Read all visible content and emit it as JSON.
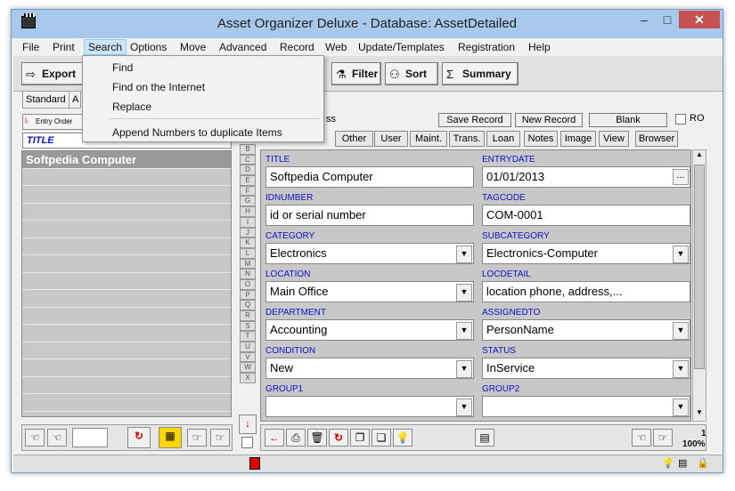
{
  "window": {
    "title": "Asset Organizer Deluxe - Database: AssetDetailed",
    "min": "–",
    "max": "□",
    "close": "✕"
  },
  "menu": [
    "File",
    "Print",
    "Search",
    "Options",
    "Move",
    "Advanced",
    "Record",
    "Web",
    "Update/Templates",
    "Registration",
    "Help"
  ],
  "toolbar": {
    "export": "Export",
    "filter": "Filter",
    "sort": "Sort",
    "summary": "Summary"
  },
  "search_menu": [
    "Find",
    "Find on the Internet",
    "Replace",
    "Append Numbers to duplicate Items"
  ],
  "left": {
    "tab_standard": "Standard",
    "tab_a": "A",
    "entry_order": "Entry Order",
    "list_header": "TITLE",
    "items": [
      "Softpedia Computer",
      "",
      "",
      "",
      "",
      "",
      "",
      "",
      "",
      "",
      "",
      "",
      "",
      "",
      ""
    ]
  },
  "record_bar": {
    "ss": "ss",
    "save": "Save Record",
    "new": "New Record",
    "blank": "Blank",
    "ro": "RO"
  },
  "tabs": [
    "Other",
    "User",
    "Maint.",
    "Trans.",
    "Loan",
    "Notes",
    "Image",
    "View",
    "Browser"
  ],
  "alpha": [
    "B",
    "C",
    "D",
    "E",
    "F",
    "G",
    "H",
    "I",
    "J",
    "K",
    "L",
    "M",
    "N",
    "O",
    "P",
    "Q",
    "R",
    "S",
    "T",
    "U",
    "V",
    "W",
    "X"
  ],
  "fields": {
    "title": {
      "label": "TITLE",
      "value": "Softpedia Computer"
    },
    "entrydate": {
      "label": "ENTRYDATE",
      "value": "01/01/2013"
    },
    "idnumber": {
      "label": "IDNUMBER",
      "value": "id or serial number"
    },
    "tagcode": {
      "label": "TAGCODE",
      "value": "COM-0001"
    },
    "category": {
      "label": "CATEGORY",
      "value": "Electronics"
    },
    "subcategory": {
      "label": "SUBCATEGORY",
      "value": "Electronics-Computer"
    },
    "location": {
      "label": "LOCATION",
      "value": "Main Office"
    },
    "locdetail": {
      "label": "LOCDETAIL",
      "value": "location phone, address,..."
    },
    "department": {
      "label": "DEPARTMENT",
      "value": "Accounting"
    },
    "assignedto": {
      "label": "ASSIGNEDTO",
      "value": "PersonName"
    },
    "condition": {
      "label": "CONDITION",
      "value": "New"
    },
    "status": {
      "label": "STATUS",
      "value": "InService"
    },
    "group1": {
      "label": "GROUP1",
      "value": ""
    },
    "group2": {
      "label": "GROUP2",
      "value": ""
    }
  },
  "footer": {
    "count": "1",
    "zoom": "100%"
  }
}
